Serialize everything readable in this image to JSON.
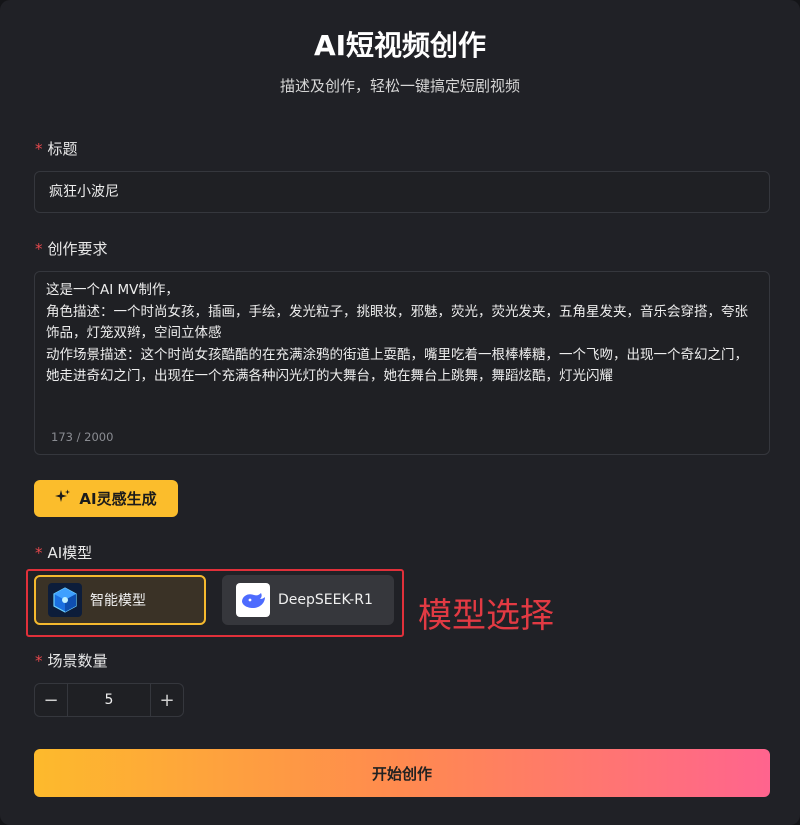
{
  "header": {
    "title": "AI短视频创作",
    "subtitle": "描述及创作，轻松一键搞定短剧视频"
  },
  "title_field": {
    "label": "标题",
    "value": "疯狂小波尼"
  },
  "requirement_field": {
    "label": "创作要求",
    "value": "这是一个AI MV制作，\n角色描述：一个时尚女孩，插画，手绘，发光粒子，挑眼妆，邪魅，荧光，荧光发夹，五角星发夹，音乐会穿搭，夸张饰品，灯笼双辫，空间立体感\n动作场景描述：这个时尚女孩酷酷的在充满涂鸦的街道上耍酷，嘴里吃着一根棒棒糖，一个飞吻，出现一个奇幻之门，她走进奇幻之门，出现在一个充满各种闪光灯的大舞台，她在舞台上跳舞，舞蹈炫酷，灯光闪耀",
    "counter": "173 / 2000"
  },
  "ai_inspire_button": {
    "label": "AI灵感生成",
    "icon": "sparkle-icon"
  },
  "model_section": {
    "label": "AI模型",
    "options": [
      {
        "label": "智能模型",
        "icon": "cube-logo-icon",
        "selected": true
      },
      {
        "label": "DeepSEEK-R1",
        "icon": "whale-logo-icon",
        "selected": false
      }
    ],
    "annotation": "模型选择"
  },
  "scene_count": {
    "label": "场景数量",
    "value": "5",
    "minus": "−",
    "plus": "+"
  },
  "start_button": {
    "label": "开始创作"
  },
  "colors": {
    "accent": "#fbbd2c",
    "required_star": "#e5484d",
    "annotation": "#e23a43",
    "gradient_start": "#fdba2c",
    "gradient_end": "#ff648e"
  }
}
